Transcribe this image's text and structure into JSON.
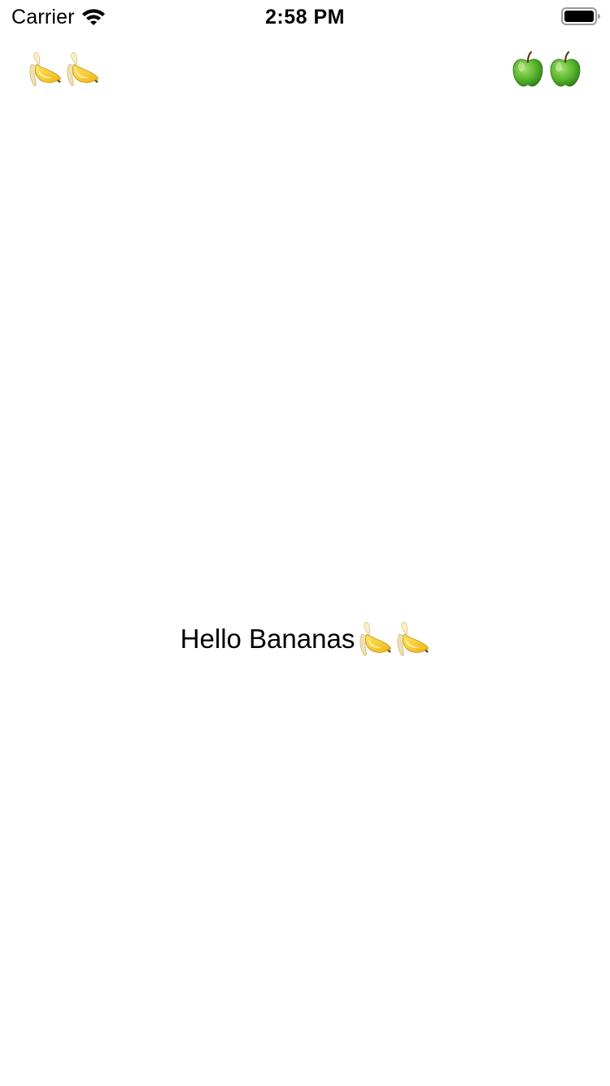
{
  "status_bar": {
    "carrier": "Carrier",
    "time": "2:58 PM",
    "wifi_icon": "wifi-icon",
    "battery_icon": "battery-full-icon"
  },
  "nav_bar": {
    "left_button": {
      "icon": "banana-icon",
      "count": 2
    },
    "right_button": {
      "icon": "green-apple-icon",
      "count": 2
    }
  },
  "main": {
    "greeting_text": "Hello Bananas",
    "trailing_icon": "banana-icon",
    "trailing_icon_count": 2
  },
  "colors": {
    "background": "#ffffff",
    "text": "#000000",
    "banana_yellow": "#f7c928",
    "banana_peel": "#efe2b8",
    "apple_green": "#4caf29"
  }
}
